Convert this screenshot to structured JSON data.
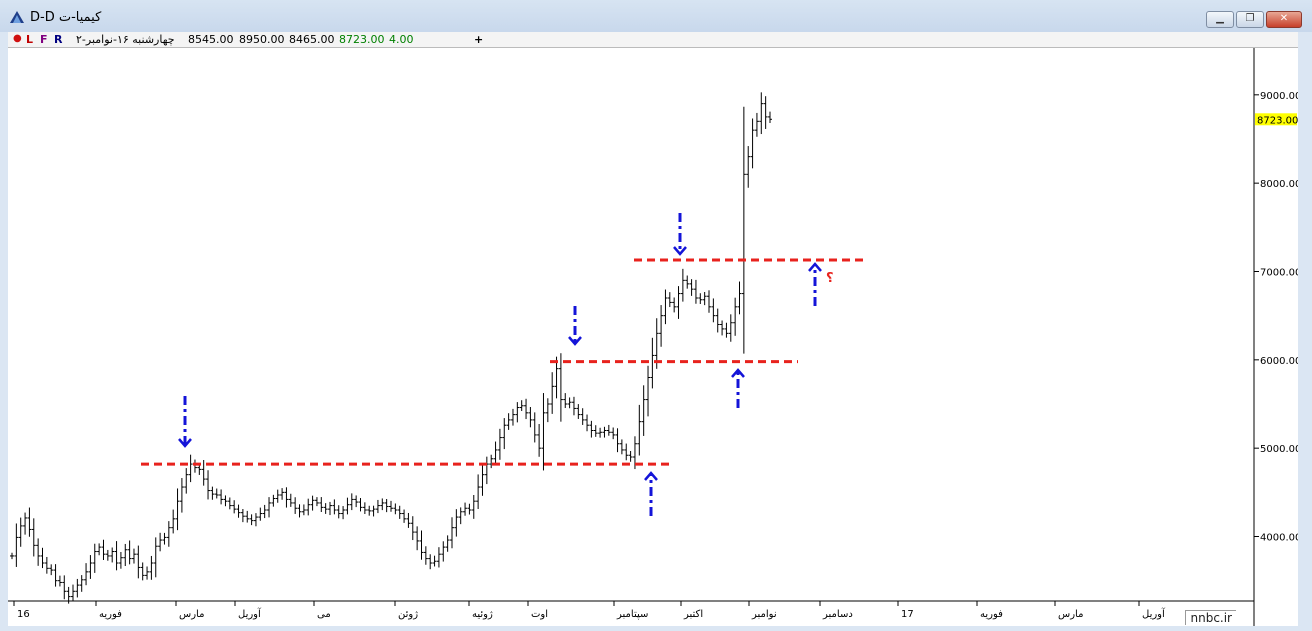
{
  "window": {
    "title": "D-D کیمیا-ت"
  },
  "infobar": {
    "l_label": "L",
    "f_label": "F",
    "r_label": "R",
    "date": "چهارشنبه ۱۶-نوامبر-۲",
    "open": "8545.00",
    "high": "8950.00",
    "low": "8465.00",
    "close": "8723.00",
    "change": "4.00",
    "add_symbol": "+"
  },
  "watermark": "nnbc.ir",
  "colors": {
    "support_resistance": "#e8221d",
    "arrows": "#1414d8",
    "last_price_bg": "#ffff00",
    "bars": "#000000"
  },
  "chart_data": {
    "type": "ohlc",
    "price_axis": {
      "ticks": [
        "4000.00",
        "5000.00",
        "6000.00",
        "7000.00",
        "8000.00",
        "9000.00"
      ],
      "last_price_label": "8723.00"
    },
    "time_axis": {
      "labels": [
        "16",
        "فوریه",
        "مارس",
        "آوریل",
        "می",
        "ژوئن",
        "ژوئیه",
        "اوت",
        "سپتامبر",
        "اکتبر",
        "نوامبر",
        "دسامبر",
        "17",
        "فوریه",
        "مارس",
        "آوریل"
      ]
    },
    "price_range": [
      3270,
      9530
    ],
    "horizontal_levels": [
      4820,
      5980,
      7130
    ],
    "question_mark": "؟",
    "closes": [
      3780,
      3990,
      4120,
      4210,
      4080,
      3900,
      3780,
      3700,
      3640,
      3620,
      3500,
      3480,
      3380,
      3320,
      3380,
      3450,
      3510,
      3600,
      3700,
      3830,
      3880,
      3800,
      3780,
      3830,
      3700,
      3760,
      3850,
      3750,
      3800,
      3650,
      3560,
      3600,
      3700,
      3890,
      3960,
      3990,
      4100,
      4200,
      4400,
      4560,
      4700,
      4820,
      4780,
      4760,
      4650,
      4520,
      4480,
      4470,
      4420,
      4400,
      4350,
      4310,
      4270,
      4230,
      4200,
      4180,
      4220,
      4260,
      4300,
      4380,
      4430,
      4470,
      4500,
      4420,
      4380,
      4320,
      4280,
      4300,
      4360,
      4410,
      4380,
      4330,
      4310,
      4350,
      4300,
      4260,
      4300,
      4360,
      4420,
      4390,
      4330,
      4300,
      4290,
      4310,
      4350,
      4380,
      4340,
      4320,
      4300,
      4260,
      4200,
      4150,
      4050,
      3950,
      3820,
      3750,
      3700,
      3720,
      3800,
      3880,
      3960,
      4100,
      4220,
      4280,
      4320,
      4300,
      4400,
      4560,
      4700,
      4820,
      4880,
      4980,
      5120,
      5260,
      5320,
      5380,
      5460,
      5480,
      5400,
      5320,
      5150,
      5000,
      5400,
      5500,
      5700,
      5900,
      5550,
      5500,
      5520,
      5450,
      5380,
      5320,
      5260,
      5200,
      5170,
      5180,
      5200,
      5180,
      5150,
      5050,
      4980,
      4920,
      4900,
      5050,
      5300,
      5550,
      5800,
      6050,
      6300,
      6500,
      6700,
      6650,
      6600,
      6750,
      6900,
      6860,
      6800,
      6700,
      6680,
      6720,
      6600,
      6500,
      6400,
      6350,
      6300,
      6420,
      6600,
      6750,
      8100,
      8300,
      8600,
      8700,
      8900,
      8750,
      8723
    ]
  }
}
